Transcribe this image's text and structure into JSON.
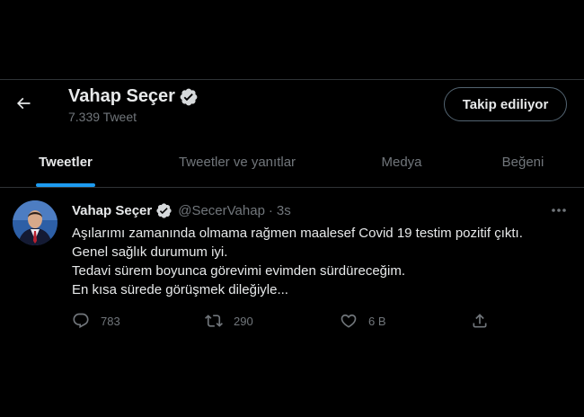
{
  "header": {
    "back_icon": "arrow-left-icon",
    "name": "Vahap Seçer",
    "verified_icon": "verified-badge-icon",
    "tweet_count": "7.339 Tweet",
    "follow_label": "Takip ediliyor"
  },
  "tabs": [
    {
      "label": "Tweetler",
      "active": true
    },
    {
      "label": "Tweetler ve yanıtlar",
      "active": false
    },
    {
      "label": "Medya",
      "active": false
    },
    {
      "label": "Beğeni",
      "active": false
    }
  ],
  "tweet": {
    "author": "Vahap Seçer",
    "handle": "@SecerVahap",
    "separator": "·",
    "time": "3s",
    "lines": [
      "Aşılarımı zamanında olmama rağmen maalesef Covid 19 testim pozitif çıktı.",
      "Genel sağlık durumum iyi.",
      "Tedavi sürem boyunca görevimi evimden sürdüreceğim.",
      "En kısa sürede görüşmek dileğiyle..."
    ],
    "actions": {
      "reply_count": "783",
      "retweet_count": "290",
      "like_count": "6 B"
    }
  },
  "colors": {
    "background": "#000000",
    "accent": "#1d9bf0",
    "text_primary": "#e7e9ea",
    "text_secondary": "#71767b",
    "divider": "#2f3336"
  }
}
